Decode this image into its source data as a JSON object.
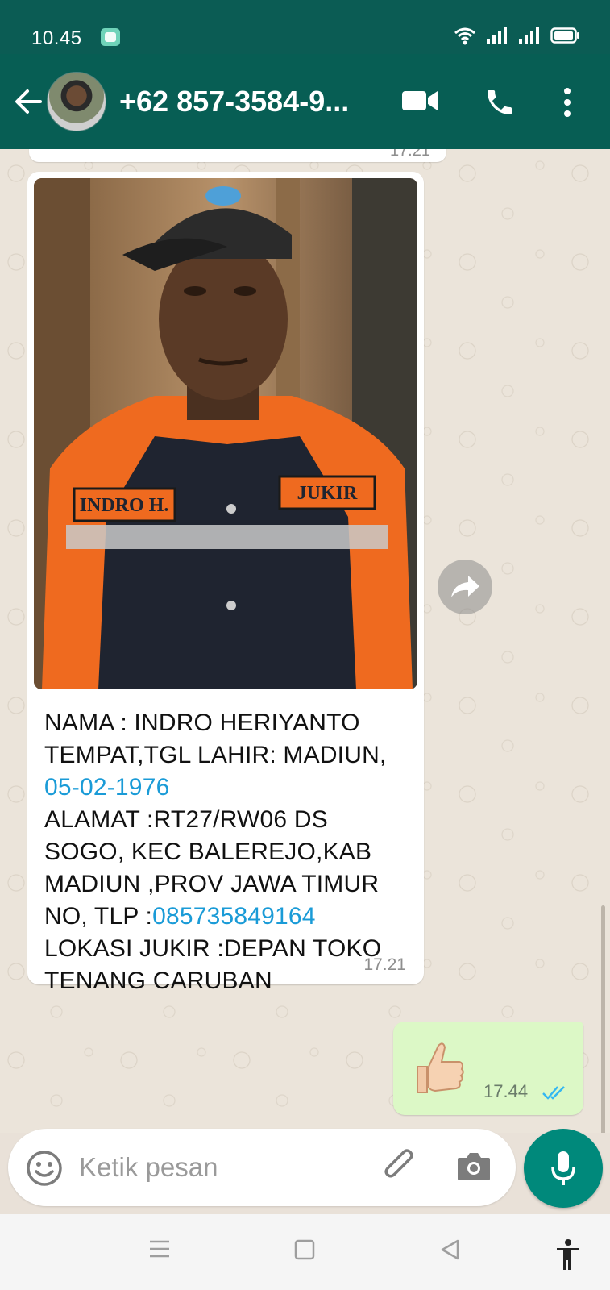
{
  "status": {
    "time": "10.45"
  },
  "header": {
    "contact": "+62 857-3584-9..."
  },
  "messages": {
    "previous_time": "17.21",
    "incoming": {
      "line1": "NAMA : INDRO HERIYANTO",
      "line2": "TEMPAT,TGL LAHIR: MADIUN,",
      "date_link": "05-02-1976",
      "line4": "ALAMAT :RT27/RW06 DS",
      "line5": "SOGO, KEC BALEREJO,KAB",
      "line6": "MADIUN ,PROV JAWA TIMUR",
      "line7_prefix": "NO, TLP :",
      "phone_link": "085735849164",
      "line8": "LOKASI JUKIR :DEPAN TOKO",
      "line9": "TENANG CARUBAN",
      "time": "17.21",
      "photo_patches": {
        "left": "INDRO H.",
        "right": "JUKIR"
      }
    },
    "outgoing": {
      "emoji": "👍",
      "time": "17.44",
      "status": "read"
    }
  },
  "composer": {
    "placeholder": "Ketik pesan"
  },
  "colors": {
    "header": "#075e54",
    "accent": "#00897b",
    "link": "#1a9bd7",
    "outgoing_bubble": "#dcf8c6"
  }
}
